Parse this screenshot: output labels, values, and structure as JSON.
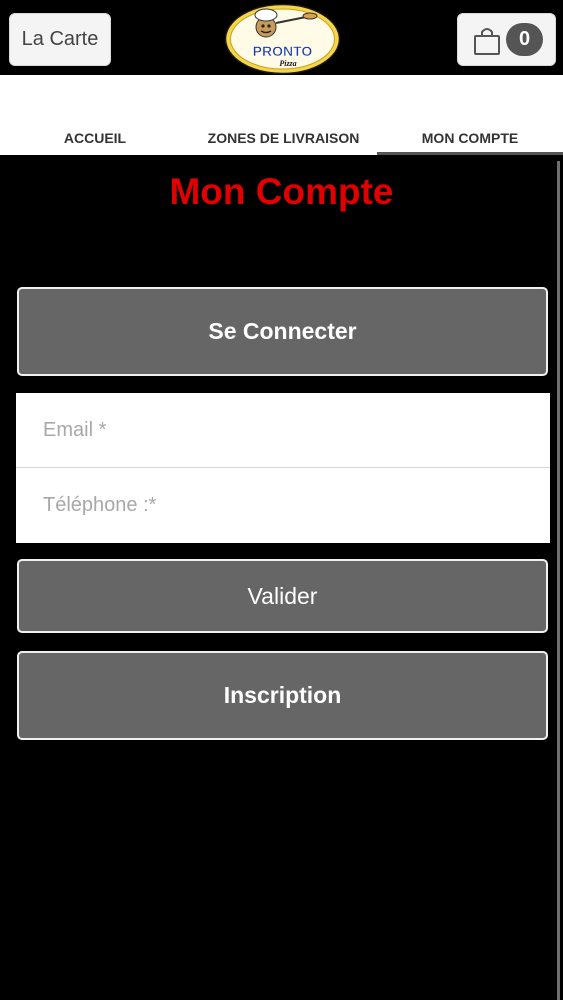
{
  "header": {
    "menu_label": "La Carte",
    "logo": {
      "brand": "PRONTO",
      "tagline": "Pizza"
    },
    "cart": {
      "icon": "shopping-bag-icon",
      "count": "0"
    }
  },
  "tabs": [
    {
      "label": "ACCUEIL",
      "active": false
    },
    {
      "label": "ZONES DE LIVRAISON",
      "active": false
    },
    {
      "label": "MON COMPTE",
      "active": true
    }
  ],
  "main": {
    "title": "Mon Compte",
    "connect_button": "Se Connecter",
    "form": {
      "email_placeholder": "Email *",
      "email_value": "",
      "phone_placeholder": "Téléphone :*",
      "phone_value": ""
    },
    "submit_button": "Valider",
    "signup_button": "Inscription"
  },
  "colors": {
    "background": "#000000",
    "accent_title": "#e00000",
    "button_gray": "#666666",
    "button_border": "#f0f0f0"
  }
}
